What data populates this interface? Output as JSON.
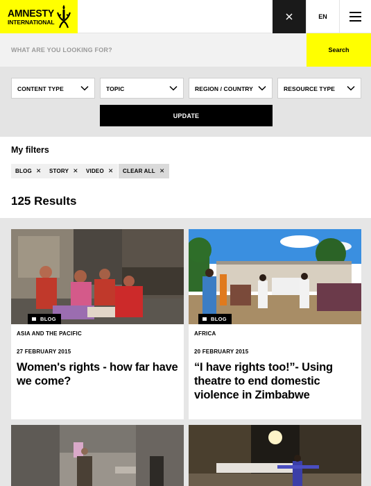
{
  "header": {
    "logo_line1": "AMNESTY",
    "logo_line2": "INTERNATIONAL",
    "language": "EN",
    "close_icon": "close-icon",
    "menu_icon": "hamburger-menu-icon",
    "brand_color": "#ffff00"
  },
  "search": {
    "placeholder": "WHAT ARE YOU LOOKING FOR?",
    "value": "",
    "button_label": "Search"
  },
  "filters": {
    "dropdowns": [
      {
        "label": "CONTENT TYPE"
      },
      {
        "label": "TOPIC"
      },
      {
        "label": "REGION / COUNTRY"
      },
      {
        "label": "RESOURCE TYPE"
      }
    ],
    "update_label": "UPDATE"
  },
  "my_filters": {
    "title": "My filters",
    "chips": [
      {
        "label": "BLOG"
      },
      {
        "label": "STORY"
      },
      {
        "label": "VIDEO"
      }
    ],
    "clear_all_label": "CLEAR ALL"
  },
  "results": {
    "count_label": "125 Results",
    "items": [
      {
        "tag": "BLOG",
        "region": "ASIA AND THE PACIFIC",
        "date": "27 FEBRUARY 2015",
        "title": "Women's rights - how far have we come?"
      },
      {
        "tag": "BLOG",
        "region": "AFRICA",
        "date": "20 FEBRUARY 2015",
        "title": "“I have rights too!”- Using theatre to end domestic violence in Zimbabwe"
      }
    ]
  }
}
